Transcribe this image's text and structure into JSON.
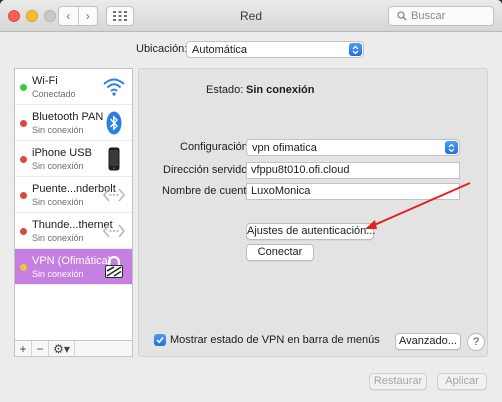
{
  "window": {
    "title": "Red"
  },
  "toolbar": {
    "back": "‹",
    "forward": "›",
    "search_placeholder": "Buscar"
  },
  "location": {
    "label": "Ubicación:",
    "value": "Automática"
  },
  "services": [
    {
      "name": "Wi-Fi",
      "status": "Conectado",
      "dot_color": "#34c84a",
      "icon": "wifi-icon"
    },
    {
      "name": "Bluetooth PAN",
      "status": "Sin conexión",
      "dot_color": "#e0453e",
      "icon": "bluetooth-icon"
    },
    {
      "name": "iPhone USB",
      "status": "Sin conexión",
      "dot_color": "#e0453e",
      "icon": "iphone-icon"
    },
    {
      "name": "Puente...nderbolt",
      "status": "Sin conexión",
      "dot_color": "#e0453e",
      "icon": "bridge-icon"
    },
    {
      "name": "Thunde...thernet",
      "status": "Sin conexión",
      "dot_color": "#e0453e",
      "icon": "thunderbolt-ethernet-icon"
    },
    {
      "name": "VPN (Ofimática)",
      "status": "Sin conexión",
      "dot_color": "#f2c33a",
      "icon": "vpn-lock-icon",
      "selected": true
    }
  ],
  "sidebar_tools": {
    "add": "+",
    "remove": "−",
    "gear": "⚙▾"
  },
  "detail": {
    "status_label": "Estado:",
    "status_value": "Sin conexión",
    "config_label": "Configuración:",
    "config_value": "vpn ofimatica",
    "server_label": "Dirección servidor:",
    "server_value": "vfppu8t010.ofi.cloud",
    "account_label": "Nombre de cuenta:",
    "account_value": "LuxoMonica",
    "auth_button": "Ajustes de autenticación...",
    "connect_button": "Conectar"
  },
  "footer": {
    "show_vpn_label": "Mostrar estado de VPN en barra de menús",
    "show_vpn_checked": true,
    "advanced_button": "Avanzado...",
    "help_button": "?",
    "revert_button": "Restaurar",
    "apply_button": "Aplicar"
  },
  "colors": {
    "selection": "#c57fe0",
    "accent": "#1f6fe0",
    "annotation_arrow": "#e5211f"
  }
}
